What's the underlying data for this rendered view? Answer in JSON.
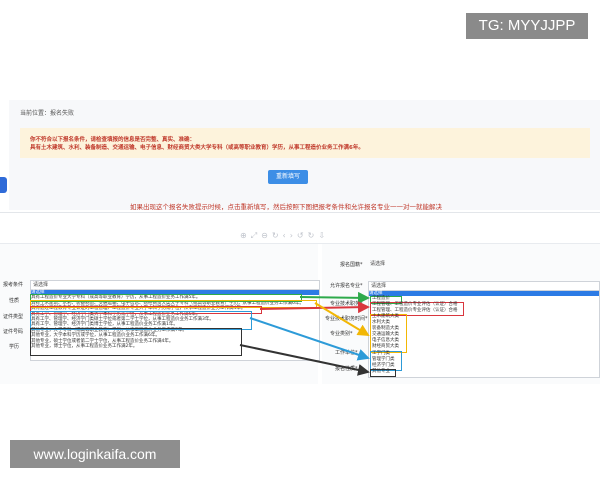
{
  "overlay": {
    "tg": "TG: MYYJJPP",
    "watermark": "www.loginkaifa.com"
  },
  "breadcrumb": "当前位置：报名失败",
  "notice": {
    "line1": "你不符合以下报名条件，请检查填报的信息是否完整、真实、准确：",
    "line2": "具有土木建筑、水利、装备制造、交通运输、电子信息、财经商贸大类大学专科（或高等职业教育）学历，从事工程造价业务工作满6年。"
  },
  "retry_button": "重新填写",
  "tip": "如果出现这个报名失败提示时候，点击重新填写，然后按照下图把报考条件和允许报名专业一一对一就能解决",
  "left_form": {
    "labels": [
      "报考条件",
      "性质",
      "证件类型",
      "证件号码",
      "学历"
    ],
    "select_placeholder": "请选择",
    "options": [
      "请选择",
      "具有工程造价专业大学专科（或高等职业教育）学历，从事工程造价业务工作满5年。",
      "具有土木建筑、水利、装备制造、交通运输、电子信息、财经商贸大类大学专科（或高等职业教育）学历，从事工程造价业务工作满6年。",
      "具有通过工程教育专业认证的工程管理、工程造价专业大学本科学历或学位，从事工程造价业务工作满4年。",
      "具有工学、管理学、经济学门类大学本科学历或学位，从事工程造价业务工作满5年。",
      "具有工学、管理学、经济学门类硕士学位或者第二学士学位，从事工程造价业务工作满3年。",
      "具有工学、管理学、经济学门类博士学位，从事工程造价业务工作满1年。",
      "其他专业，大学专科（或高等职业教育）学历，从事工程造价业务工作满7年。",
      "其他专业，大学本科学历或学位，从事工程造价业务工作满6年。",
      "其他专业，硕士学位或者第二学士学位，从事工程造价业务工作满4年。",
      "其他专业，博士学位，从事工程造价业务工作满2年。"
    ]
  },
  "right_form": {
    "labels": [
      "报名国籍*",
      "允许报名专业*",
      "专业技术职务*",
      "专业技术职务时间*",
      "专业类别*",
      "工作单位*",
      "报名性质*"
    ],
    "select_placeholder": "请选择",
    "green": [
      "工程造价"
    ],
    "red": [
      "工程管理、工程造价专业评估（认证）合格",
      "工程管理、工程造价专业评估（认证）合格"
    ],
    "yellow": [
      "土木建筑大类",
      "水利大类",
      "装备制造大类",
      "交通运输大类",
      "电子信息大类",
      "财经商贸大类"
    ],
    "blue": [
      "工学门类",
      "管理学门类",
      "经济学门类"
    ],
    "black": [
      "其他专业"
    ]
  },
  "colors": {
    "green": "#2eaa4b",
    "red": "#d9363e",
    "yellow": "#f2b705",
    "blue": "#2d9bd8",
    "black": "#333333"
  }
}
